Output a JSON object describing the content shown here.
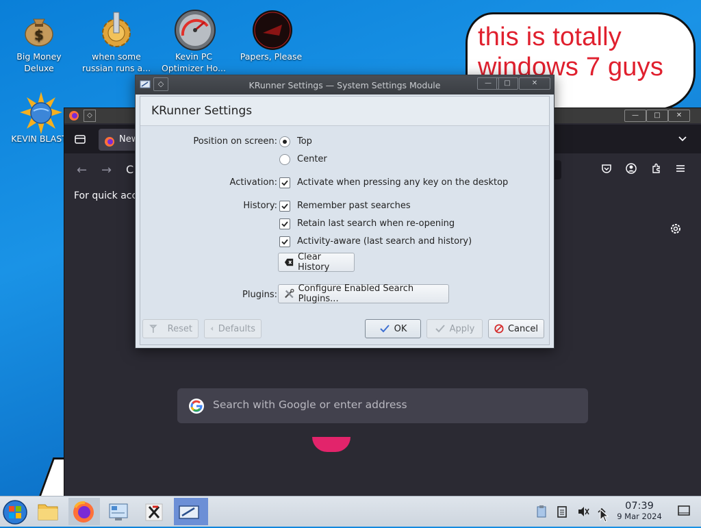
{
  "desktop": {
    "icons": [
      {
        "label1": "Big Money",
        "label2": "Deluxe"
      },
      {
        "label1": "when some",
        "label2": "russian runs a..."
      },
      {
        "label1": "Kevin PC",
        "label2": "Optimizer Ho..."
      },
      {
        "label1": "Papers, Please",
        "label2": ""
      },
      {
        "label1": "KEVIN BLAST",
        "label2": ""
      }
    ],
    "bubble": {
      "line1": "this is totally",
      "line2": "windows 7 guys"
    }
  },
  "firefox": {
    "tab_label": "New",
    "quick_text": "For quick acc",
    "search_placeholder": "Search with Google or enter address"
  },
  "dialog": {
    "window_title": "KRunner Settings — System Settings Module",
    "header": "KRunner Settings",
    "position": {
      "label": "Position on screen:",
      "options": [
        "Top",
        "Center"
      ],
      "selected": "Top"
    },
    "activation": {
      "label": "Activation:",
      "option": "Activate when pressing any key on the desktop",
      "checked": true
    },
    "history": {
      "label": "History:",
      "options": [
        {
          "text": "Remember past searches",
          "checked": true
        },
        {
          "text": "Retain last search when re-opening",
          "checked": true
        },
        {
          "text": "Activity-aware (last search and history)",
          "checked": true
        }
      ],
      "clear_button": "Clear History"
    },
    "plugins": {
      "label": "Plugins:",
      "button": "Configure Enabled Search Plugins..."
    },
    "buttons": {
      "reset": "Reset",
      "defaults": "Defaults",
      "ok": "OK",
      "apply": "Apply",
      "cancel": "Cancel"
    }
  },
  "taskbar": {
    "time": "07:39",
    "date": "9 Mar 2024"
  },
  "colors": {
    "accent": "#3d6fd1",
    "bubble_text": "#e0202e",
    "desktop": "#0a7fd8"
  }
}
